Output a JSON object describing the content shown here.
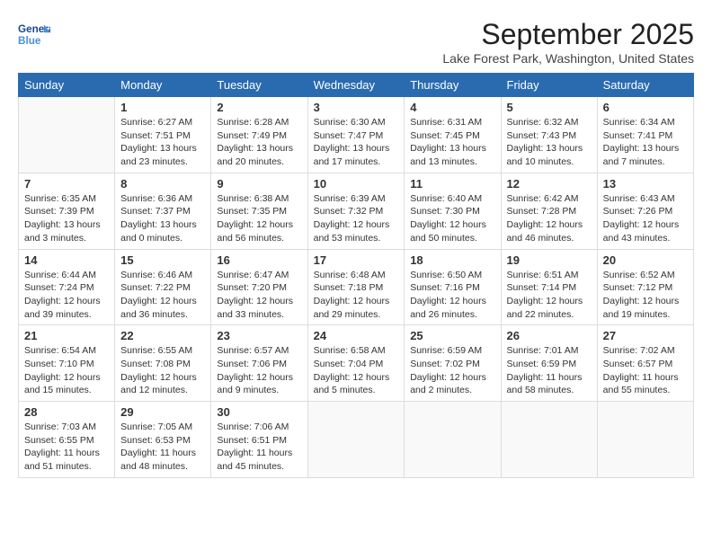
{
  "logo": {
    "general": "General",
    "blue": "Blue"
  },
  "title": "September 2025",
  "location": "Lake Forest Park, Washington, United States",
  "days_of_week": [
    "Sunday",
    "Monday",
    "Tuesday",
    "Wednesday",
    "Thursday",
    "Friday",
    "Saturday"
  ],
  "weeks": [
    [
      {
        "day": "",
        "info": ""
      },
      {
        "day": "1",
        "info": "Sunrise: 6:27 AM\nSunset: 7:51 PM\nDaylight: 13 hours\nand 23 minutes."
      },
      {
        "day": "2",
        "info": "Sunrise: 6:28 AM\nSunset: 7:49 PM\nDaylight: 13 hours\nand 20 minutes."
      },
      {
        "day": "3",
        "info": "Sunrise: 6:30 AM\nSunset: 7:47 PM\nDaylight: 13 hours\nand 17 minutes."
      },
      {
        "day": "4",
        "info": "Sunrise: 6:31 AM\nSunset: 7:45 PM\nDaylight: 13 hours\nand 13 minutes."
      },
      {
        "day": "5",
        "info": "Sunrise: 6:32 AM\nSunset: 7:43 PM\nDaylight: 13 hours\nand 10 minutes."
      },
      {
        "day": "6",
        "info": "Sunrise: 6:34 AM\nSunset: 7:41 PM\nDaylight: 13 hours\nand 7 minutes."
      }
    ],
    [
      {
        "day": "7",
        "info": "Sunrise: 6:35 AM\nSunset: 7:39 PM\nDaylight: 13 hours\nand 3 minutes."
      },
      {
        "day": "8",
        "info": "Sunrise: 6:36 AM\nSunset: 7:37 PM\nDaylight: 13 hours\nand 0 minutes."
      },
      {
        "day": "9",
        "info": "Sunrise: 6:38 AM\nSunset: 7:35 PM\nDaylight: 12 hours\nand 56 minutes."
      },
      {
        "day": "10",
        "info": "Sunrise: 6:39 AM\nSunset: 7:32 PM\nDaylight: 12 hours\nand 53 minutes."
      },
      {
        "day": "11",
        "info": "Sunrise: 6:40 AM\nSunset: 7:30 PM\nDaylight: 12 hours\nand 50 minutes."
      },
      {
        "day": "12",
        "info": "Sunrise: 6:42 AM\nSunset: 7:28 PM\nDaylight: 12 hours\nand 46 minutes."
      },
      {
        "day": "13",
        "info": "Sunrise: 6:43 AM\nSunset: 7:26 PM\nDaylight: 12 hours\nand 43 minutes."
      }
    ],
    [
      {
        "day": "14",
        "info": "Sunrise: 6:44 AM\nSunset: 7:24 PM\nDaylight: 12 hours\nand 39 minutes."
      },
      {
        "day": "15",
        "info": "Sunrise: 6:46 AM\nSunset: 7:22 PM\nDaylight: 12 hours\nand 36 minutes."
      },
      {
        "day": "16",
        "info": "Sunrise: 6:47 AM\nSunset: 7:20 PM\nDaylight: 12 hours\nand 33 minutes."
      },
      {
        "day": "17",
        "info": "Sunrise: 6:48 AM\nSunset: 7:18 PM\nDaylight: 12 hours\nand 29 minutes."
      },
      {
        "day": "18",
        "info": "Sunrise: 6:50 AM\nSunset: 7:16 PM\nDaylight: 12 hours\nand 26 minutes."
      },
      {
        "day": "19",
        "info": "Sunrise: 6:51 AM\nSunset: 7:14 PM\nDaylight: 12 hours\nand 22 minutes."
      },
      {
        "day": "20",
        "info": "Sunrise: 6:52 AM\nSunset: 7:12 PM\nDaylight: 12 hours\nand 19 minutes."
      }
    ],
    [
      {
        "day": "21",
        "info": "Sunrise: 6:54 AM\nSunset: 7:10 PM\nDaylight: 12 hours\nand 15 minutes."
      },
      {
        "day": "22",
        "info": "Sunrise: 6:55 AM\nSunset: 7:08 PM\nDaylight: 12 hours\nand 12 minutes."
      },
      {
        "day": "23",
        "info": "Sunrise: 6:57 AM\nSunset: 7:06 PM\nDaylight: 12 hours\nand 9 minutes."
      },
      {
        "day": "24",
        "info": "Sunrise: 6:58 AM\nSunset: 7:04 PM\nDaylight: 12 hours\nand 5 minutes."
      },
      {
        "day": "25",
        "info": "Sunrise: 6:59 AM\nSunset: 7:02 PM\nDaylight: 12 hours\nand 2 minutes."
      },
      {
        "day": "26",
        "info": "Sunrise: 7:01 AM\nSunset: 6:59 PM\nDaylight: 11 hours\nand 58 minutes."
      },
      {
        "day": "27",
        "info": "Sunrise: 7:02 AM\nSunset: 6:57 PM\nDaylight: 11 hours\nand 55 minutes."
      }
    ],
    [
      {
        "day": "28",
        "info": "Sunrise: 7:03 AM\nSunset: 6:55 PM\nDaylight: 11 hours\nand 51 minutes."
      },
      {
        "day": "29",
        "info": "Sunrise: 7:05 AM\nSunset: 6:53 PM\nDaylight: 11 hours\nand 48 minutes."
      },
      {
        "day": "30",
        "info": "Sunrise: 7:06 AM\nSunset: 6:51 PM\nDaylight: 11 hours\nand 45 minutes."
      },
      {
        "day": "",
        "info": ""
      },
      {
        "day": "",
        "info": ""
      },
      {
        "day": "",
        "info": ""
      },
      {
        "day": "",
        "info": ""
      }
    ]
  ]
}
